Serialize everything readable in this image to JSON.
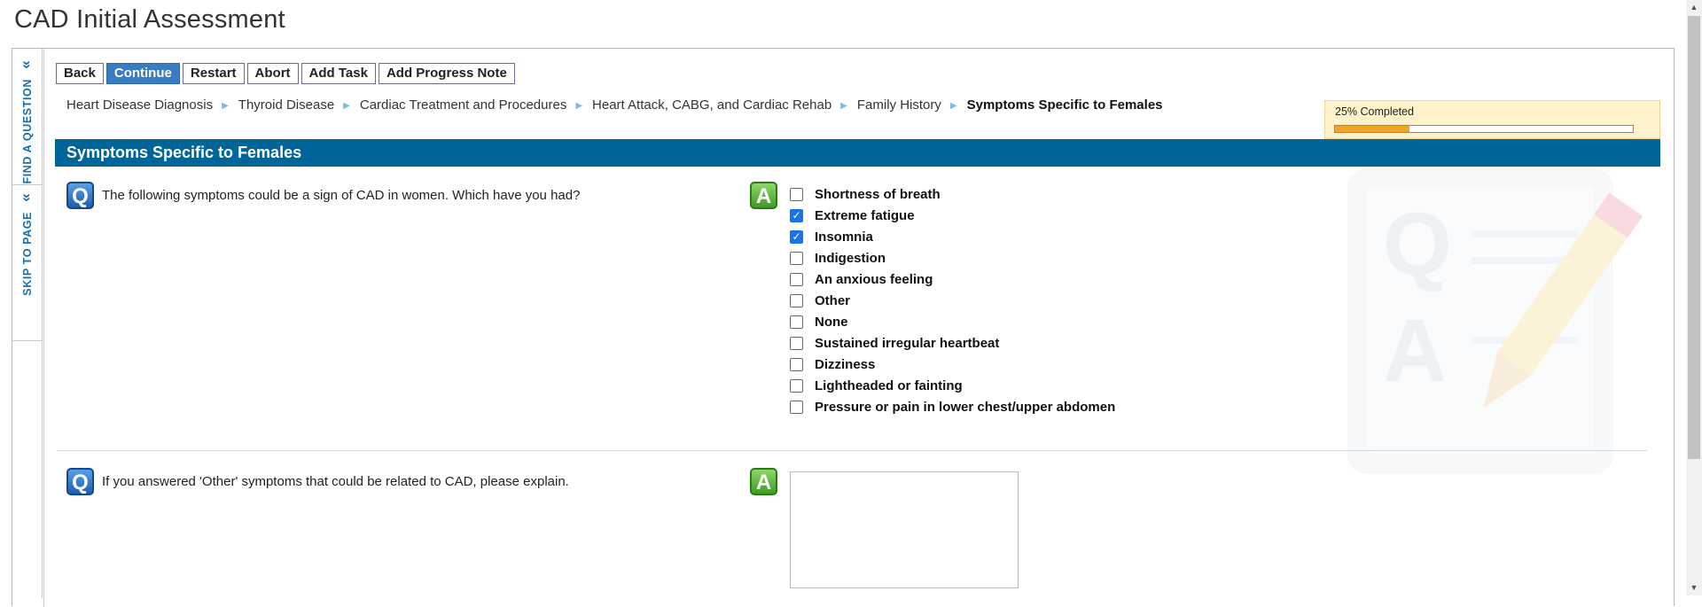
{
  "page": {
    "title": "CAD Initial Assessment"
  },
  "side_nav": {
    "find_question": "FIND A QUESTION",
    "skip_to_page": "SKIP TO PAGE"
  },
  "toolbar": {
    "back": "Back",
    "continue": "Continue",
    "restart": "Restart",
    "abort": "Abort",
    "add_task": "Add Task",
    "add_progress_note": "Add Progress Note"
  },
  "breadcrumb": [
    "Heart Disease Diagnosis",
    "Thyroid Disease",
    "Cardiac Treatment and Procedures",
    "Heart Attack, CABG, and Cardiac Rehab",
    "Family History",
    "Symptoms Specific to Females"
  ],
  "progress": {
    "label": "25% Completed",
    "fraction": 0.25,
    "color": "#f0a623"
  },
  "section": {
    "title": "Symptoms Specific to Females",
    "color": "#006699"
  },
  "icons": {
    "question": "Q",
    "answer": "A"
  },
  "questions": [
    {
      "text": "The following symptoms could be a sign of CAD in women. Which have you had?",
      "options": [
        {
          "label": "Shortness of breath",
          "checked": false
        },
        {
          "label": "Extreme fatigue",
          "checked": true
        },
        {
          "label": "Insomnia",
          "checked": true
        },
        {
          "label": "Indigestion",
          "checked": false
        },
        {
          "label": "An anxious feeling",
          "checked": false
        },
        {
          "label": "Other",
          "checked": false
        },
        {
          "label": "None",
          "checked": false
        },
        {
          "label": "Sustained irregular heartbeat",
          "checked": false
        },
        {
          "label": "Dizziness",
          "checked": false
        },
        {
          "label": "Lightheaded or fainting",
          "checked": false
        },
        {
          "label": "Pressure or pain in lower chest/upper abdomen",
          "checked": false
        }
      ]
    },
    {
      "text": "If you answered 'Other' symptoms that could be related to CAD, please explain.",
      "value": ""
    }
  ]
}
